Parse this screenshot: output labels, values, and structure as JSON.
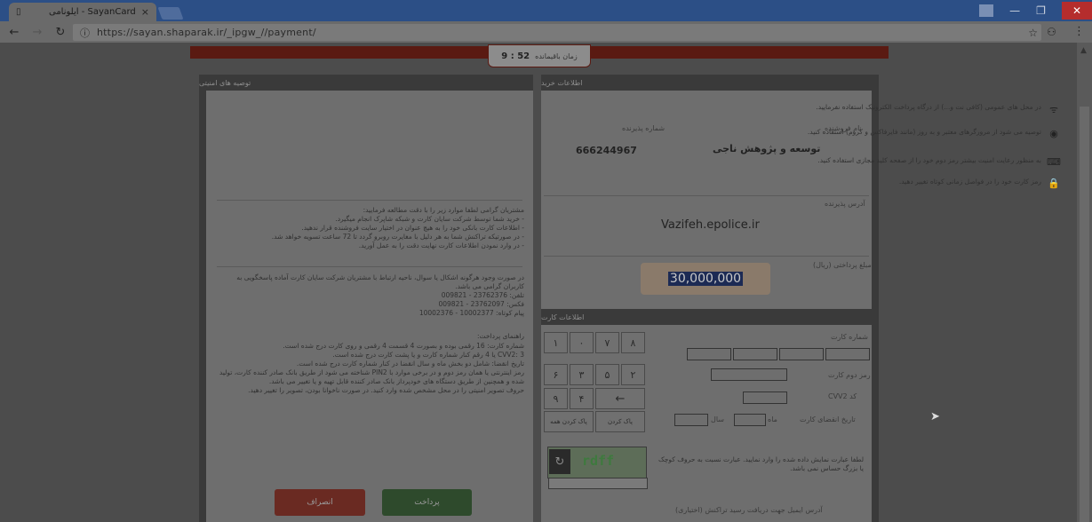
{
  "browser": {
    "tab_title": "SayanCard - ایلونامی",
    "tab_close": "×",
    "url": "https://sayan.shaparak.ir/_ipgw_//payment/",
    "icons": {
      "back": "arrow-left",
      "forward": "arrow-right",
      "reload": "reload",
      "info": "info",
      "bookmark": "star",
      "menu": "kebab",
      "profile": "person"
    }
  },
  "timer": {
    "label": "زمان باقیمانده",
    "value": "52 : 9"
  },
  "purchase_info": {
    "header": "اطلاعات خرید",
    "merchant_label": "نام فروشنده",
    "merchant_value": "توسعه و پژوهش ناجی",
    "terminal_label": "شماره پذیرنده",
    "terminal_value": "666244967",
    "site_label": "آدرس پذیرنده",
    "site_value": "Vazifeh.epolice.ir",
    "amount_label": "مبلغ پرداختی (ریال)",
    "amount_value": "30,000,000"
  },
  "card_info": {
    "header": "اطلاعات کارت",
    "card_number_label": "شماره کارت",
    "pin2_label": "رمز دوم کارت",
    "cvv2_label": "کد CVV2",
    "expiry_label": "تاریخ انقضای کارت",
    "month_label": "ماه",
    "year_label": "سال",
    "keypad": [
      "۸",
      "۷",
      "۰",
      "۱",
      "۲",
      "۵",
      "۳",
      "۶",
      "←",
      "۴",
      "۹"
    ],
    "keypad_clear": "پاک کردن",
    "keypad_clear_all": "پاک کردن همه",
    "captcha_text": "rdff",
    "captcha_hint": "لطفا عبارت نمایش داده شده را وارد نمایید. عبارت نسبت به حروف کوچک یا بزرگ حساس نمی باشد.",
    "email_label": "آدرس ایمیل جهت دریافت رسید تراکنش (اختیاری)"
  },
  "security": {
    "header": "توصیه های امنیتی",
    "tips": [
      {
        "icon": "wifi-icon",
        "text": "در محل های عمومی (کافی نت و...) از درگاه پرداخت الکترونیک استفاده نفرمایید."
      },
      {
        "icon": "headset-icon",
        "text": "توصیه می شود از مرورگرهای معتبر و به روز (مانند فایرفاکس و کروم) استفاده کنید."
      },
      {
        "icon": "keyboard-icon",
        "text": "به منظور رعایت امنیت بیشتر رمز دوم خود را از صفحه کلید مجازی استفاده کنید."
      },
      {
        "icon": "lock-icon",
        "text": "رمز کارت خود را در فواصل زمانی کوتاه تغییر دهید."
      }
    ],
    "notice": "مشتریان گرامی لطفا موارد زیر را با دقت مطالعه فرمایید:\n- خرید شما توسط شرکت سایان کارت و شبکه شاپرک انجام میگیرد.\n- اطلاعات کارت بانکی خود را به هیچ عنوان در اختیار سایت فروشنده قرار ندهید.\n- در صورتیکه تراکنش شما به هر دلیل با مغایرت روبرو گردد تا 72 ساعت تسویه خواهد شد.\n- در وارد نمودن اطلاعات کارت نهایت دقت را به عمل آورید.",
    "support": "در صورت وجود هرگونه اشکال یا سوال، ناحیه ارتباط با مشتریان شرکت سایان کارت آماده پاسخگویی به کاربران گرامی می باشد.\nتلفن: 23762376 - 009821\nفکس: 23762097 - 009821\nپیام کوتاه: 10002377 - 10002376",
    "guide_title": "راهنمای پرداخت:",
    "guide": "شماره کارت: 16 رقمی بوده و بصورت 4 قسمت 4 رقمی و روی کارت درج شده است.\nCVV2: 3 یا 4 رقم کنار شماره کارت و یا پشت کارت درج شده است.\nتاریخ انقضا: شامل دو بخش ماه و سال انقضا در کنار شماره کارت درج شده است.\nرمز اینترنتی یا همان رمز دوم و در برخی موارد با PIN2 شناخته می شود از طریق بانک صادر کننده کارت، تولید شده و همچنین از طریق دستگاه های خودپرداز بانک صادر کننده قابل تهیه و یا تغییر می باشد.\nحروف تصویر امنیتی را در محل مشخص شده وارد کنید. در صورت ناخوانا بودن، تصویر را تغییر دهید."
  },
  "buttons": {
    "pay": "پرداخت",
    "cancel": "انصراف"
  }
}
